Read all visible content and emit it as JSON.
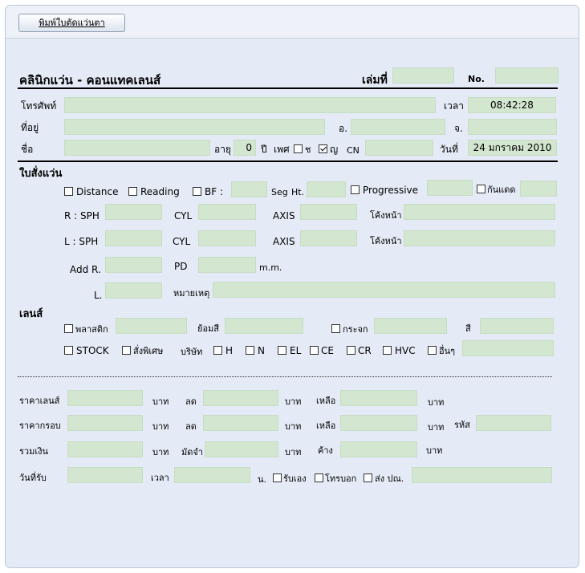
{
  "toolbar": {
    "print_label": "พิมพ์ใบตัดแว่นตา"
  },
  "header": {
    "title": "คลินิกแว่น - คอนแทคเลนส์",
    "book_label": "เล่มที่",
    "book_value": "",
    "no_label": "No.",
    "no_value": ""
  },
  "contact": {
    "phone_label": "โทรศัพท์",
    "phone_value": "",
    "time_label": "เวลา",
    "time_value": "08:42:28",
    "address_label": "ที่อยู่",
    "address_value": "",
    "district_label": "อ.",
    "district_value": "",
    "province_label": "จ.",
    "province_value": "",
    "name_label": "ชื่อ",
    "name_value": "",
    "age_label": "อายุ",
    "age_value": "0",
    "years_label": "ปี",
    "sex_label": "เพศ",
    "male_label": "ช",
    "male_checked": false,
    "female_label": "ญ",
    "female_checked": true,
    "cn_label": "CN",
    "cn_value": "",
    "date_label": "วันที่",
    "date_value": "24 มกราคม 2010"
  },
  "prescription": {
    "section_label": "ใบสั่งแว่น",
    "distance_label": "Distance",
    "reading_label": "Reading",
    "bf_label": "BF :",
    "bf_value": "",
    "seg_label": "Seg",
    "ht_label": "Ht.",
    "ht_value": "",
    "progressive_label": "Progressive",
    "progressive_value": "",
    "antiglare_label": "กันแดด",
    "antiglare_value": "",
    "r_sph_label": "R : SPH",
    "r_sph_value": "",
    "r_cyl_label": "CYL",
    "r_cyl_value": "",
    "r_axis_label": "AXIS",
    "r_axis_value": "",
    "r_curve_label": "โค้งหน้า",
    "r_curve_value": "",
    "l_sph_label": "L : SPH",
    "l_sph_value": "",
    "l_cyl_label": "CYL",
    "l_cyl_value": "",
    "l_axis_label": "AXIS",
    "l_axis_value": "",
    "l_curve_label": "โค้งหน้า",
    "l_curve_value": "",
    "add_r_label": "Add R.",
    "add_r_value": "",
    "pd_label": "PD",
    "pd_value": "",
    "mm_label": "m.m.",
    "add_l_label": "L.",
    "add_l_value": "",
    "note_label": "หมายเหตุ",
    "note_value": ""
  },
  "lens": {
    "section_label": "เลนส์",
    "plastic_label": "พลาสติก",
    "plastic_value": "",
    "tint_label": "ย้อมสี",
    "tint_value": "",
    "glass_label": "กระจก",
    "glass_value": "",
    "color_label": "สี",
    "color_value": "",
    "stock_label": "STOCK",
    "special_label": "สั่งพิเศษ",
    "company_label": "บริษัท",
    "h_label": "H",
    "n_label": "N",
    "el_label": "EL",
    "ce_label": "CE",
    "cr_label": "CR",
    "hvc_label": "HVC",
    "other_label": "อื่นๆ",
    "other_value": ""
  },
  "payment": {
    "lens_price_label": "ราคาเลนส์",
    "frame_price_label": "ราคากรอบ",
    "total_label": "รวมเงิน",
    "pickup_label": "วันที่รับ",
    "baht": "บาท",
    "discount_label": "ลด",
    "deposit_label": "มัดจำ",
    "remain_label": "เหลือ",
    "owe_label": "ค้าง",
    "code_label": "รหัส",
    "time_label": "เวลา",
    "hour_label": "น.",
    "self_pickup_label": "รับเอง",
    "phone_notify_label": "โทรบอก",
    "mail_label": "ส่ง ปณ."
  }
}
